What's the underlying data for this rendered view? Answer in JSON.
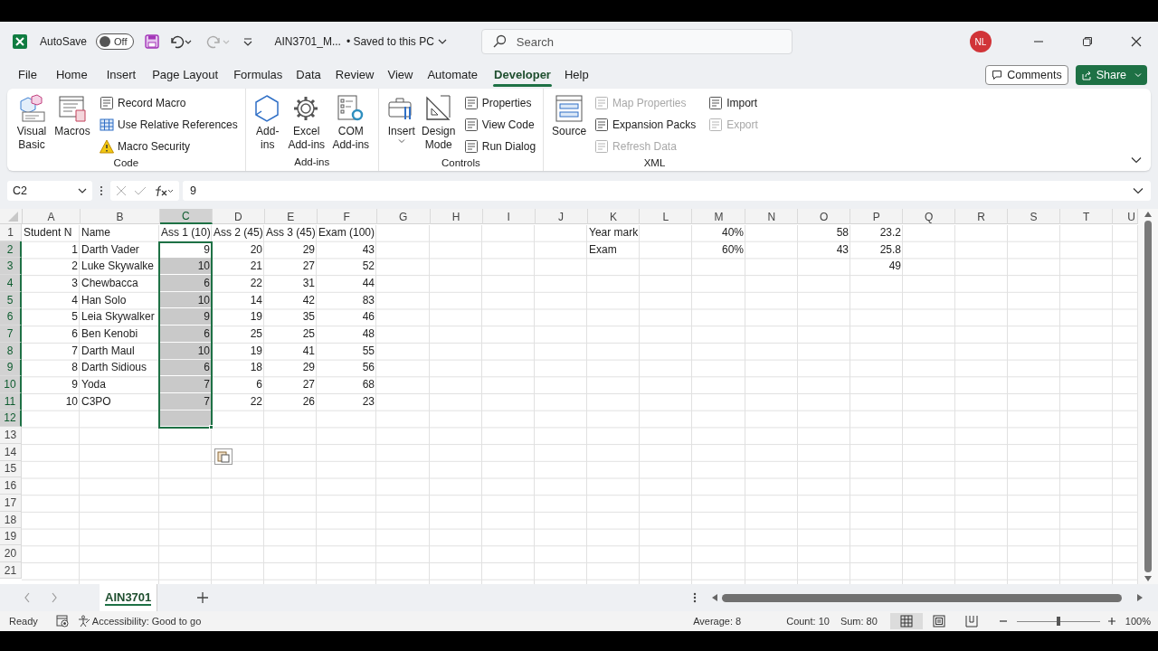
{
  "title_bar": {
    "autosave_label": "AutoSave",
    "autosave": {
      "on": false,
      "label": "Off"
    },
    "file_name": "AIN3701_M...",
    "save_status": "• Saved to this PC",
    "search": {
      "placeholder": "Search"
    },
    "avatar": "NL"
  },
  "menu_tabs": [
    {
      "label": "File",
      "selected": false
    },
    {
      "label": "Home",
      "selected": false
    },
    {
      "label": "Insert",
      "selected": false
    },
    {
      "label": "Page Layout",
      "selected": false
    },
    {
      "label": "Formulas",
      "selected": false
    },
    {
      "label": "Data",
      "selected": false
    },
    {
      "label": "Review",
      "selected": false
    },
    {
      "label": "View",
      "selected": false
    },
    {
      "label": "Automate",
      "selected": false
    },
    {
      "label": "Developer",
      "selected": true
    },
    {
      "label": "Help",
      "selected": false
    }
  ],
  "comments_button": "Comments",
  "share_button": "Share",
  "ribbon": {
    "groups": [
      {
        "label": "Code",
        "large": [
          {
            "label": "Visual Basic"
          },
          {
            "label": "Macros"
          }
        ],
        "small": [
          {
            "label": "Record Macro",
            "disabled": false
          },
          {
            "label": "Use Relative References",
            "disabled": false
          },
          {
            "label": "Macro Security",
            "disabled": false
          }
        ]
      },
      {
        "label": "Add-ins",
        "large": [
          {
            "label": "Add-ins"
          },
          {
            "label": "Excel Add-ins"
          },
          {
            "label": "COM Add-ins"
          }
        ]
      },
      {
        "label": "Controls",
        "large": [
          {
            "label": "Insert"
          },
          {
            "label": "Design Mode"
          }
        ],
        "small": [
          {
            "label": "Properties",
            "disabled": false
          },
          {
            "label": "View Code",
            "disabled": false
          },
          {
            "label": "Run Dialog",
            "disabled": false
          }
        ]
      },
      {
        "label": "XML",
        "large": [
          {
            "label": "Source"
          }
        ],
        "small": [
          {
            "label": "Map Properties",
            "disabled": true
          },
          {
            "label": "Expansion Packs",
            "disabled": false
          },
          {
            "label": "Refresh Data",
            "disabled": true
          },
          {
            "label": "Import",
            "disabled": false
          },
          {
            "label": "Export",
            "disabled": true
          }
        ]
      }
    ]
  },
  "formula_bar": {
    "name_box": "C2",
    "value": "9"
  },
  "columns": [
    {
      "label": "A",
      "selected": false
    },
    {
      "label": "B",
      "selected": false
    },
    {
      "label": "C",
      "selected": true
    },
    {
      "label": "D",
      "selected": false
    },
    {
      "label": "E",
      "selected": false
    },
    {
      "label": "F",
      "selected": false
    },
    {
      "label": "G",
      "selected": false
    },
    {
      "label": "H",
      "selected": false
    },
    {
      "label": "I",
      "selected": false
    },
    {
      "label": "J",
      "selected": false
    },
    {
      "label": "K",
      "selected": false
    },
    {
      "label": "L",
      "selected": false
    },
    {
      "label": "M",
      "selected": false
    },
    {
      "label": "N",
      "selected": false
    },
    {
      "label": "O",
      "selected": false
    },
    {
      "label": "P",
      "selected": false
    },
    {
      "label": "Q",
      "selected": false
    },
    {
      "label": "R",
      "selected": false
    },
    {
      "label": "S",
      "selected": false
    },
    {
      "label": "T",
      "selected": false
    },
    {
      "label": "U",
      "selected": false
    }
  ],
  "rows": [
    {
      "header": "1",
      "selected": false,
      "cells": [
        {
          "text": "Student N",
          "kind": "text"
        },
        {
          "text": "Name",
          "kind": "text"
        },
        {
          "text": "Ass 1 (10)",
          "kind": "text"
        },
        {
          "text": "Ass 2 (45)",
          "kind": "text"
        },
        {
          "text": "Ass 3 (45)",
          "kind": "text"
        },
        {
          "text": "Exam (100)",
          "kind": "text"
        },
        null,
        null,
        null,
        null,
        {
          "text": "Year mark",
          "kind": "text"
        },
        null,
        {
          "text": "40%",
          "kind": "number"
        },
        null,
        {
          "text": "58",
          "kind": "number"
        },
        {
          "text": "23.2",
          "kind": "number"
        }
      ]
    },
    {
      "header": "2",
      "selected": true,
      "cells": [
        {
          "text": "1",
          "kind": "number"
        },
        {
          "text": "Darth Vader",
          "kind": "text"
        },
        {
          "text": "9",
          "kind": "number"
        },
        {
          "text": "20",
          "kind": "number"
        },
        {
          "text": "29",
          "kind": "number"
        },
        {
          "text": "43",
          "kind": "number"
        },
        null,
        null,
        null,
        null,
        {
          "text": "Exam",
          "kind": "text"
        },
        null,
        {
          "text": "60%",
          "kind": "number"
        },
        null,
        {
          "text": "43",
          "kind": "number"
        },
        {
          "text": "25.8",
          "kind": "number"
        }
      ]
    },
    {
      "header": "3",
      "selected": true,
      "cells": [
        {
          "text": "2",
          "kind": "number"
        },
        {
          "text": "Luke Skywalke",
          "kind": "text"
        },
        {
          "text": "10",
          "kind": "number"
        },
        {
          "text": "21",
          "kind": "number"
        },
        {
          "text": "27",
          "kind": "number"
        },
        {
          "text": "52",
          "kind": "number"
        },
        null,
        null,
        null,
        null,
        null,
        null,
        null,
        null,
        null,
        {
          "text": "49",
          "kind": "number"
        }
      ]
    },
    {
      "header": "4",
      "selected": true,
      "cells": [
        {
          "text": "3",
          "kind": "number"
        },
        {
          "text": "Chewbacca",
          "kind": "text"
        },
        {
          "text": "6",
          "kind": "number"
        },
        {
          "text": "22",
          "kind": "number"
        },
        {
          "text": "31",
          "kind": "number"
        },
        {
          "text": "44",
          "kind": "number"
        }
      ]
    },
    {
      "header": "5",
      "selected": true,
      "cells": [
        {
          "text": "4",
          "kind": "number"
        },
        {
          "text": "Han Solo",
          "kind": "text"
        },
        {
          "text": "10",
          "kind": "number"
        },
        {
          "text": "14",
          "kind": "number"
        },
        {
          "text": "42",
          "kind": "number"
        },
        {
          "text": "83",
          "kind": "number"
        }
      ]
    },
    {
      "header": "6",
      "selected": true,
      "cells": [
        {
          "text": "5",
          "kind": "number"
        },
        {
          "text": "Leia Skywalker",
          "kind": "text"
        },
        {
          "text": "9",
          "kind": "number"
        },
        {
          "text": "19",
          "kind": "number"
        },
        {
          "text": "35",
          "kind": "number"
        },
        {
          "text": "46",
          "kind": "number"
        }
      ]
    },
    {
      "header": "7",
      "selected": true,
      "cells": [
        {
          "text": "6",
          "kind": "number"
        },
        {
          "text": "Ben Kenobi",
          "kind": "text"
        },
        {
          "text": "6",
          "kind": "number"
        },
        {
          "text": "25",
          "kind": "number"
        },
        {
          "text": "25",
          "kind": "number"
        },
        {
          "text": "48",
          "kind": "number"
        }
      ]
    },
    {
      "header": "8",
      "selected": true,
      "cells": [
        {
          "text": "7",
          "kind": "number"
        },
        {
          "text": "Darth Maul",
          "kind": "text"
        },
        {
          "text": "10",
          "kind": "number"
        },
        {
          "text": "19",
          "kind": "number"
        },
        {
          "text": "41",
          "kind": "number"
        },
        {
          "text": "55",
          "kind": "number"
        }
      ]
    },
    {
      "header": "9",
      "selected": true,
      "cells": [
        {
          "text": "8",
          "kind": "number"
        },
        {
          "text": "Darth Sidious",
          "kind": "text"
        },
        {
          "text": "6",
          "kind": "number"
        },
        {
          "text": "18",
          "kind": "number"
        },
        {
          "text": "29",
          "kind": "number"
        },
        {
          "text": "56",
          "kind": "number"
        }
      ]
    },
    {
      "header": "10",
      "selected": true,
      "cells": [
        {
          "text": "9",
          "kind": "number"
        },
        {
          "text": "Yoda",
          "kind": "text"
        },
        {
          "text": "7",
          "kind": "number"
        },
        {
          "text": "6",
          "kind": "number"
        },
        {
          "text": "27",
          "kind": "number"
        },
        {
          "text": "68",
          "kind": "number"
        }
      ]
    },
    {
      "header": "11",
      "selected": true,
      "cells": [
        {
          "text": "10",
          "kind": "number"
        },
        {
          "text": "C3PO",
          "kind": "text"
        },
        {
          "text": "7",
          "kind": "number"
        },
        {
          "text": "22",
          "kind": "number"
        },
        {
          "text": "26",
          "kind": "number"
        },
        {
          "text": "23",
          "kind": "number"
        }
      ]
    },
    {
      "header": "12",
      "selected": true,
      "cells": []
    },
    {
      "header": "13",
      "selected": false,
      "cells": []
    },
    {
      "header": "14",
      "selected": false,
      "cells": []
    },
    {
      "header": "15",
      "selected": false,
      "cells": []
    },
    {
      "header": "16",
      "selected": false,
      "cells": []
    },
    {
      "header": "17",
      "selected": false,
      "cells": []
    },
    {
      "header": "18",
      "selected": false,
      "cells": []
    },
    {
      "header": "19",
      "selected": false,
      "cells": []
    },
    {
      "header": "20",
      "selected": false,
      "cells": []
    },
    {
      "header": "21",
      "selected": false,
      "cells": []
    }
  ],
  "sheet_tabs": [
    {
      "label": "AIN3701",
      "selected": true
    }
  ],
  "status_bar": {
    "mode": "Ready",
    "accessibility": "Accessibility: Good to go",
    "average": "Average: 8",
    "count": "Count: 10",
    "sum": "Sum: 80",
    "views": [
      {
        "selected": true
      },
      {
        "selected": false
      },
      {
        "selected": false
      }
    ],
    "zoom": {
      "level": 0.5,
      "label": "100%"
    }
  }
}
